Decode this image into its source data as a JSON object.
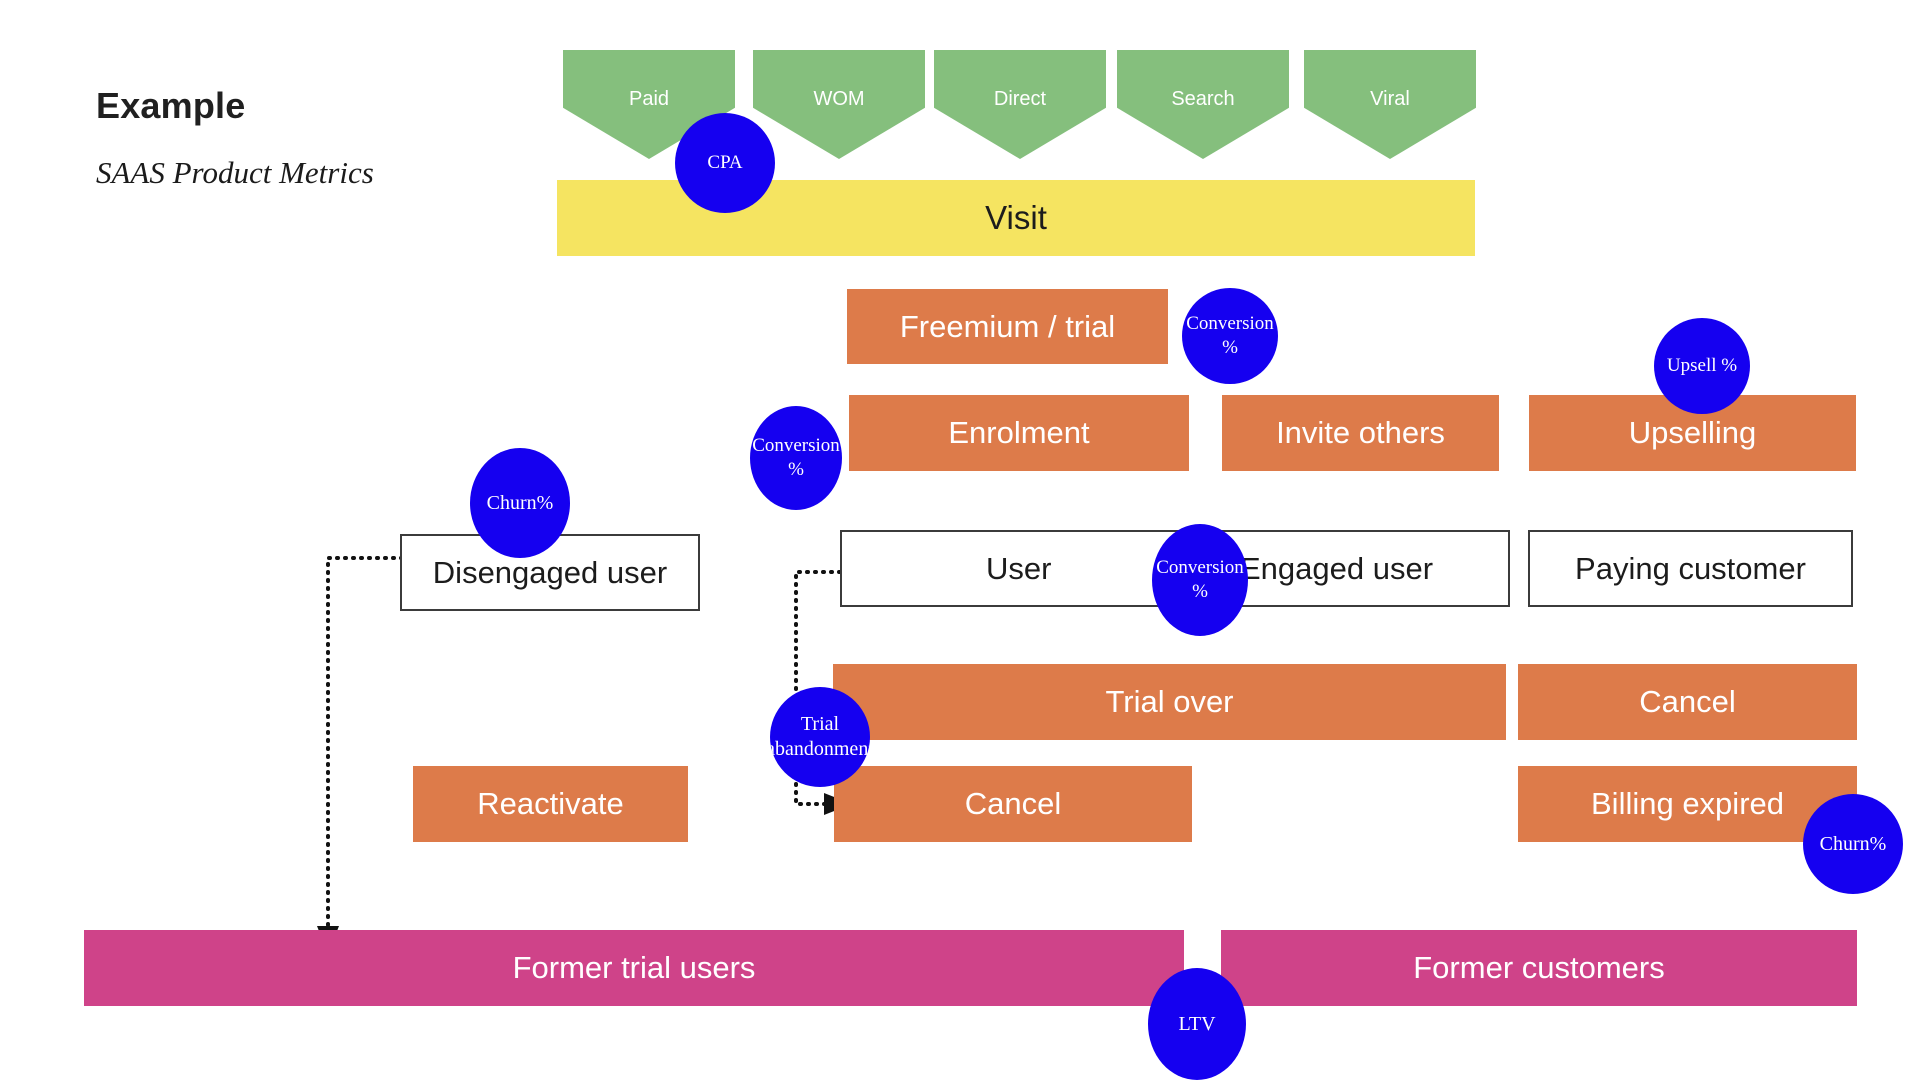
{
  "heading": {
    "title": "Example",
    "subtitle": "SAAS Product Metrics"
  },
  "colors": {
    "acquisition_green": "#85bf7d",
    "visit_yellow": "#f5e461",
    "action_orange": "#dd7b4a",
    "state_border": "#3b3b3b",
    "terminal_pink": "#cf4389",
    "metric_blue": "#1500f0",
    "background": "#ffffff"
  },
  "acquisition_channels": [
    {
      "label": "Paid"
    },
    {
      "label": "WOM"
    },
    {
      "label": "Direct"
    },
    {
      "label": "Search"
    },
    {
      "label": "Viral"
    }
  ],
  "visit_stage": {
    "label": "Visit"
  },
  "activation_stages": [
    {
      "label": "Freemium / trial"
    },
    {
      "label": "Enrolment"
    },
    {
      "label": "Invite others"
    },
    {
      "label": "Upselling"
    }
  ],
  "state_boxes": [
    {
      "label": "Disengaged user"
    },
    {
      "label": "User"
    },
    {
      "label": "Engaged user"
    },
    {
      "label": "Paying customer"
    }
  ],
  "churn_actions": [
    {
      "label": "Trial over"
    },
    {
      "label": "Cancel"
    },
    {
      "label": "Reactivate"
    },
    {
      "label": "Cancel"
    },
    {
      "label": "Billing expired"
    }
  ],
  "terminal_stages": [
    {
      "label": "Former trial users"
    },
    {
      "label": "Former customers"
    }
  ],
  "metrics": [
    {
      "id": "cpa",
      "line1": "CPA",
      "line2": ""
    },
    {
      "id": "conversion-trial",
      "line1": "Conversion",
      "line2": "%"
    },
    {
      "id": "upsell",
      "line1": "Upsell %",
      "line2": ""
    },
    {
      "id": "conversion-enrol",
      "line1": "Conversion",
      "line2": "%"
    },
    {
      "id": "churn-disengaged",
      "line1": "Churn%",
      "line2": ""
    },
    {
      "id": "conversion-engaged",
      "line1": "Conversion",
      "line2": "%"
    },
    {
      "id": "trial-abandonment",
      "line1": "Trial",
      "line2": "abandonment"
    },
    {
      "id": "churn-billing",
      "line1": "Churn%",
      "line2": ""
    },
    {
      "id": "ltv",
      "line1": "LTV",
      "line2": ""
    }
  ],
  "connectors": [
    {
      "id": "disengaged-to-former-trial-users"
    },
    {
      "id": "user-to-cancel"
    }
  ]
}
